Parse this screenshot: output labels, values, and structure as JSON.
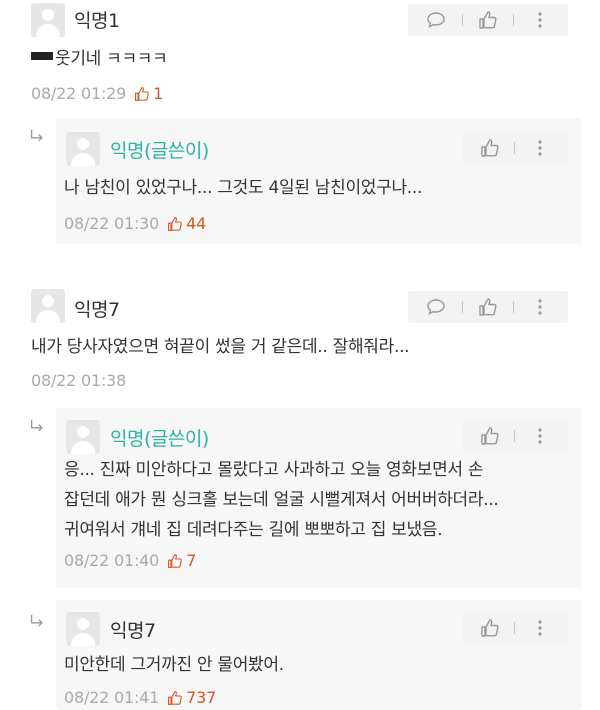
{
  "comments": [
    {
      "author": "익명1",
      "text": "웃기네 ㅋㅋㅋㅋ",
      "date": "08/22 01:29",
      "likes": "1"
    },
    {
      "author": "익명(글쓴이)",
      "text": "나 남친이 있었구나... 그것도 4일된 남친이었구나...",
      "date": "08/22 01:30",
      "likes": "44"
    },
    {
      "author": "익명7",
      "text": "내가 당사자였으면 혀끝이 썼을 거 같은데.. 잘해줘라...",
      "date": "08/22 01:38"
    },
    {
      "author": "익명(글쓴이)",
      "lines": [
        "응... 진짜 미안하다고 몰랐다고 사과하고 오늘 영화보면서 손",
        "잡던데 애가 뭔 싱크홀 보는데 얼굴 시뻘게져서 어버버하더라...",
        "귀여워서 걔네 집 데려다주는 길에 뽀뽀하고 집 보냈음."
      ],
      "date": "08/22 01:40",
      "likes": "7"
    },
    {
      "author": "익명7",
      "text": "미안한데 그거까진 안 물어봤어.",
      "date": "08/22 01:41",
      "likes": "737"
    }
  ],
  "icons": {
    "comment": "speech-bubble-icon",
    "like": "thumbs-up-icon",
    "more": "more-vertical-icon",
    "reply": "reply-arrow-icon"
  },
  "colors": {
    "writer": "#2bb3a3",
    "likes": "#d4582a"
  }
}
